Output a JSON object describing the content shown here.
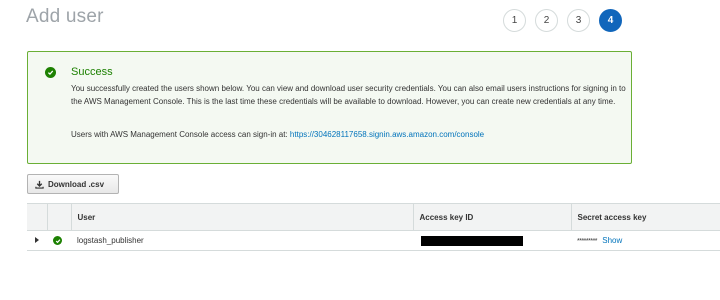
{
  "header": {
    "title": "Add user",
    "steps": [
      "1",
      "2",
      "3",
      "4"
    ],
    "active_step": "4"
  },
  "success": {
    "title": "Success",
    "message": "You successfully created the users shown below. You can view and download user security credentials. You can also email users instructions for signing in to the AWS Management Console. This is the last time these credentials will be available to download. However, you can create new credentials at any time.",
    "console_prefix": "Users with AWS Management Console access can sign-in at:",
    "console_url": "https://304628117658.signin.aws.amazon.com/console",
    "icon": "check-circle-icon",
    "color": "#1d8102"
  },
  "actions": {
    "download_label": "Download .csv",
    "download_icon": "download-icon"
  },
  "table": {
    "columns": [
      "User",
      "Access key ID",
      "Secret access key"
    ],
    "rows": [
      {
        "user": "logstash_publisher",
        "access_key_id": "[redacted]",
        "secret_mask": "*********",
        "show_label": "Show"
      }
    ]
  },
  "colors": {
    "accent": "#1166bb",
    "link": "#0073bb",
    "success_border": "#6aaf35"
  }
}
